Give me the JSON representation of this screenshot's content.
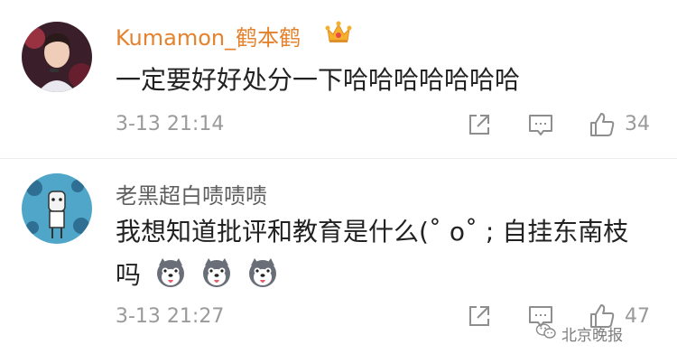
{
  "comments": [
    {
      "username": "Kumamon_鹤本鹤",
      "badge_icon": "crown-icon",
      "text": "一定要好好处分一下哈哈哈哈哈哈哈",
      "time": "3-13 21:14",
      "likes": "34",
      "actions": [
        "share-icon",
        "reply-icon",
        "like-icon"
      ]
    },
    {
      "username": "老黑超白啧啧啧",
      "text_line1": "我想知道批评和教育是什么(˚ o˚ ; 自挂东南枝",
      "text_line2": "吗",
      "emoji_icons": [
        "husky-emoji-icon",
        "husky-emoji-icon",
        "husky-emoji-icon"
      ],
      "time": "3-13 21:27",
      "likes": "47",
      "actions": [
        "share-icon",
        "reply-icon",
        "like-icon"
      ]
    }
  ],
  "watermark": {
    "text": "北京晚报",
    "icon": "wechat-icon"
  },
  "colors": {
    "vip_name": "#e4822e",
    "name": "#5f5f5f",
    "meta": "#9a9a9a",
    "text": "#222222"
  }
}
